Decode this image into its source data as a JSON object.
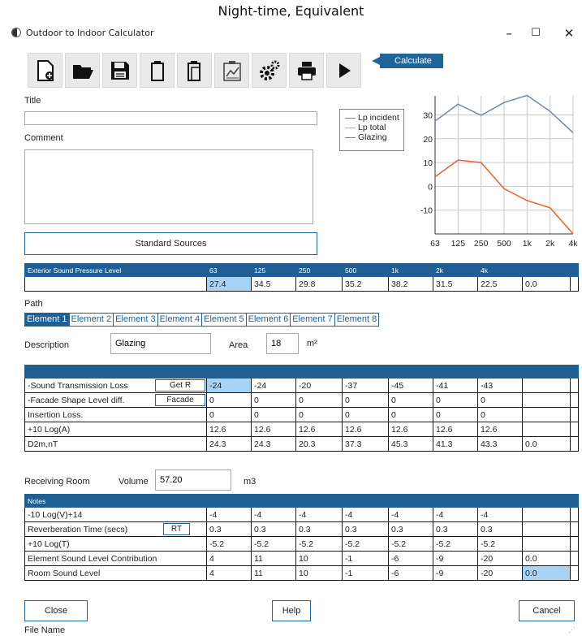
{
  "caption": "Night-time, Equivalent",
  "window": {
    "title": "Outdoor to Indoor Calculator",
    "minimize": "–",
    "maximize": "☐",
    "close": "✕"
  },
  "toolbar": {
    "calculate_label": "Calculate"
  },
  "form": {
    "title_label": "Title",
    "title_value": "",
    "comment_label": "Comment",
    "comment_value": "",
    "standard_sources_label": "Standard Sources"
  },
  "legend": [
    {
      "label": "Lp incident",
      "color": "#6f86a8"
    },
    {
      "label": "Lp total",
      "color": "#f0a44c"
    },
    {
      "label": "Glazing",
      "color": "#e8622b"
    }
  ],
  "chart_data": {
    "type": "line",
    "categories": [
      "63",
      "125",
      "250",
      "500",
      "1k",
      "2k",
      "4k"
    ],
    "series": [
      {
        "name": "Lp incident",
        "values": [
          27.4,
          34.5,
          29.8,
          35.2,
          38.2,
          31.5,
          22.5
        ],
        "color": "#6f86a8"
      },
      {
        "name": "Glazing",
        "values": [
          4,
          11,
          10,
          -1,
          -6,
          -9,
          -20
        ],
        "color": "#e8622b"
      }
    ],
    "yticks": [
      "30",
      "20",
      "10",
      "0",
      "-10"
    ],
    "ylim": [
      -20,
      38
    ],
    "grid": true,
    "legend": "left"
  },
  "exterior": {
    "header": [
      "Exterior Sound Pressure Level",
      "63",
      "125",
      "250",
      "500",
      "1k",
      "2k",
      "4k",
      ""
    ],
    "values": [
      "",
      "27.4",
      "34.5",
      "29.8",
      "35.2",
      "38.2",
      "31.5",
      "22.5",
      "0.0"
    ]
  },
  "path_label": "Path",
  "tabs": [
    "Element 1",
    "Element 2",
    "Element 3",
    "Element 4",
    "Element 5",
    "Element 6",
    "Element 7",
    "Element 8"
  ],
  "element": {
    "description_label": "Description",
    "description_value": "Glazing",
    "area_label": "Area",
    "area_value": "18",
    "area_unit": "m²"
  },
  "path_table": {
    "rows": [
      {
        "label": "-Sound Transmission Loss",
        "button": "Get R",
        "values": [
          "-24",
          "-24",
          "-20",
          "-37",
          "-45",
          "-41",
          "-43",
          ""
        ]
      },
      {
        "label": "-Facade Shape Level diff.",
        "button": "Facade",
        "values": [
          "0",
          "0",
          "0",
          "0",
          "0",
          "0",
          "0",
          ""
        ]
      },
      {
        "label": "Insertion Loss.",
        "button": "",
        "values": [
          "0",
          "0",
          "0",
          "0",
          "0",
          "0",
          "0",
          ""
        ]
      },
      {
        "label": "+10 Log(A)",
        "button": "",
        "values": [
          "12.6",
          "12.6",
          "12.6",
          "12.6",
          "12.6",
          "12.6",
          "12.6",
          ""
        ]
      },
      {
        "label": "D2m,nT",
        "button": "",
        "values": [
          "24.3",
          "24.3",
          "20.3",
          "37.3",
          "45.3",
          "41.3",
          "43.3",
          "0.0"
        ]
      }
    ]
  },
  "room": {
    "label": "Receiving Room",
    "volume_label": "Volume",
    "volume_value": "57.20",
    "volume_unit": "m3"
  },
  "room_table": {
    "header": "Notes",
    "rows": [
      {
        "label": "-10 Log(V)+14",
        "button": "",
        "values": [
          "-4",
          "-4",
          "-4",
          "-4",
          "-4",
          "-4",
          "-4",
          ""
        ]
      },
      {
        "label": "Reverberation Time (secs)",
        "button": "RT",
        "values": [
          "0.3",
          "0.3",
          "0.3",
          "0.3",
          "0.3",
          "0.3",
          "0.3",
          ""
        ]
      },
      {
        "label": "+10 Log(T)",
        "button": "",
        "values": [
          "-5.2",
          "-5.2",
          "-5.2",
          "-5.2",
          "-5.2",
          "-5.2",
          "-5.2",
          ""
        ]
      },
      {
        "label": "Element Sound Level Contribution",
        "button": "",
        "values": [
          "4",
          "11",
          "10",
          "-1",
          "-6",
          "-9",
          "-20",
          "0.0"
        ]
      },
      {
        "label": "Room Sound Level",
        "button": "",
        "values": [
          "4",
          "11",
          "10",
          "-1",
          "-6",
          "-9",
          "-20",
          "0.0"
        ]
      }
    ]
  },
  "footer": {
    "close": "Close",
    "help": "Help",
    "cancel": "Cancel",
    "file_name": "File Name"
  }
}
